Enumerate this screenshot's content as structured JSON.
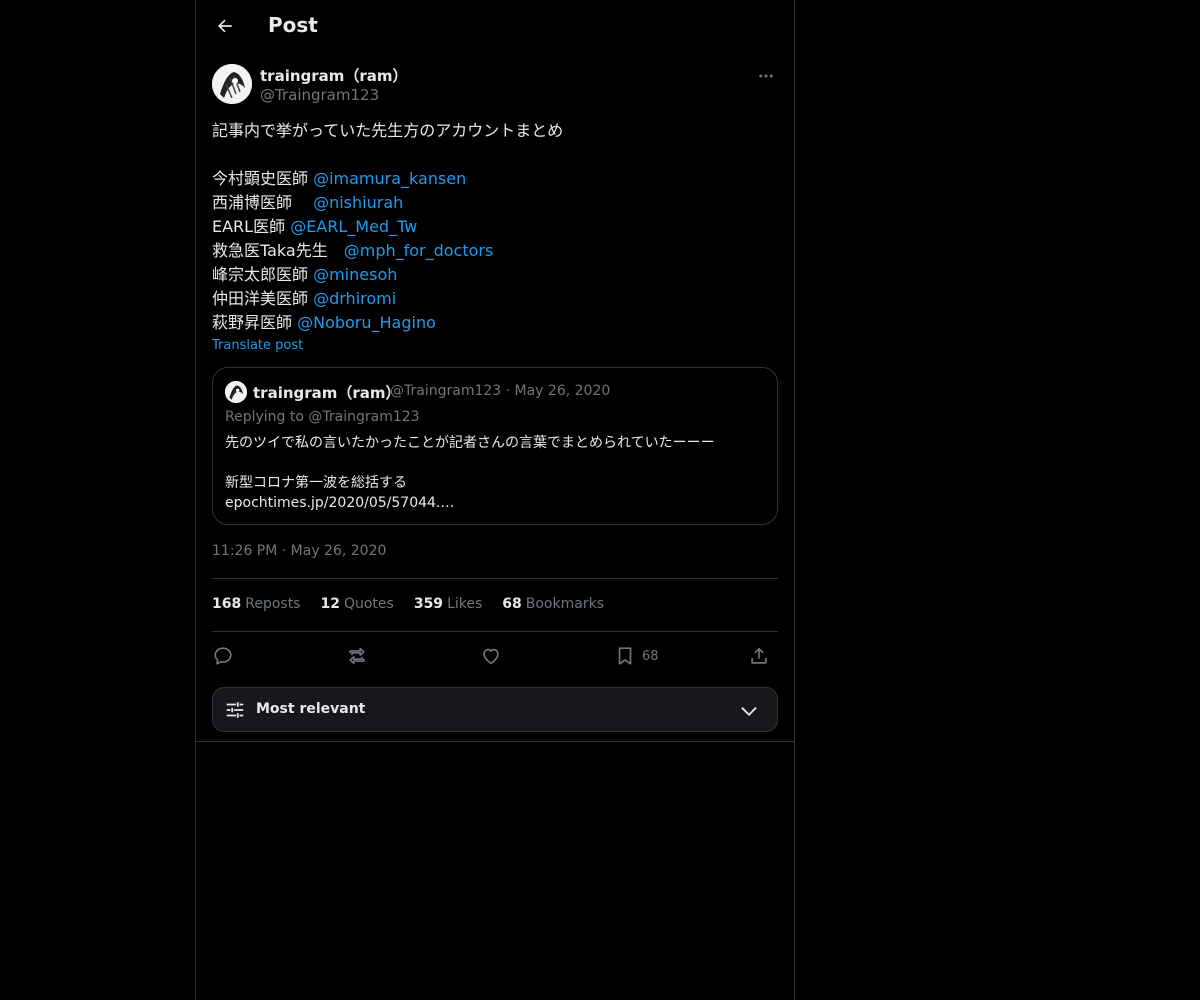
{
  "header": {
    "title": "Post"
  },
  "post": {
    "author": {
      "display_name": "traingram（ram）",
      "handle": "@Traingram123"
    },
    "body": {
      "intro": "記事内で挙がっていた先生方のアカウントまとめ",
      "accounts": [
        {
          "label": "今村顕史医師 ",
          "mention": "@imamura_kansen"
        },
        {
          "label": "西浦博医師　 ",
          "mention": "@nishiurah"
        },
        {
          "label": "EARL医師 ",
          "mention": "@EARL_Med_Tw"
        },
        {
          "label": "救急医Taka先生　",
          "mention": "@mph_for_doctors"
        },
        {
          "label": "峰宗太郎医師 ",
          "mention": "@minesoh"
        },
        {
          "label": "仲田洋美医師 ",
          "mention": "@drhiromi"
        },
        {
          "label": "萩野昇医師 ",
          "mention": "@Noboru_Hagino"
        }
      ]
    },
    "translate_label": "Translate post",
    "quote": {
      "display_name": "traingram（ram）",
      "meta": "@Traingram123 · May 26, 2020",
      "replying_to": "Replying to @Traingram123",
      "lines": [
        "先のツイで私の言いたかったことが記者さんの言葉でまとめられていたーーー",
        "",
        "新型コロナ第一波を総括する",
        "epochtimes.jp/2020/05/57044.…"
      ]
    },
    "timestamp": "11:26 PM · May 26, 2020",
    "stats": {
      "reposts": {
        "count": "168",
        "label": "Reposts"
      },
      "quotes": {
        "count": "12",
        "label": "Quotes"
      },
      "likes": {
        "count": "359",
        "label": "Likes"
      },
      "bookmarks": {
        "count": "68",
        "label": "Bookmarks"
      }
    },
    "actions": {
      "bookmark_count": "68"
    }
  },
  "replies_sort": {
    "label": "Most relevant"
  },
  "icons": [
    "back-arrow-icon",
    "more-icon",
    "reply-icon",
    "repost-icon",
    "like-icon",
    "bookmark-icon",
    "share-icon",
    "sliders-icon",
    "chevron-down-icon"
  ],
  "colors": {
    "background": "#000000",
    "text": "#e7e9ea",
    "secondary": "#71767b",
    "accent": "#1d9bf0",
    "border": "#2f3336"
  }
}
